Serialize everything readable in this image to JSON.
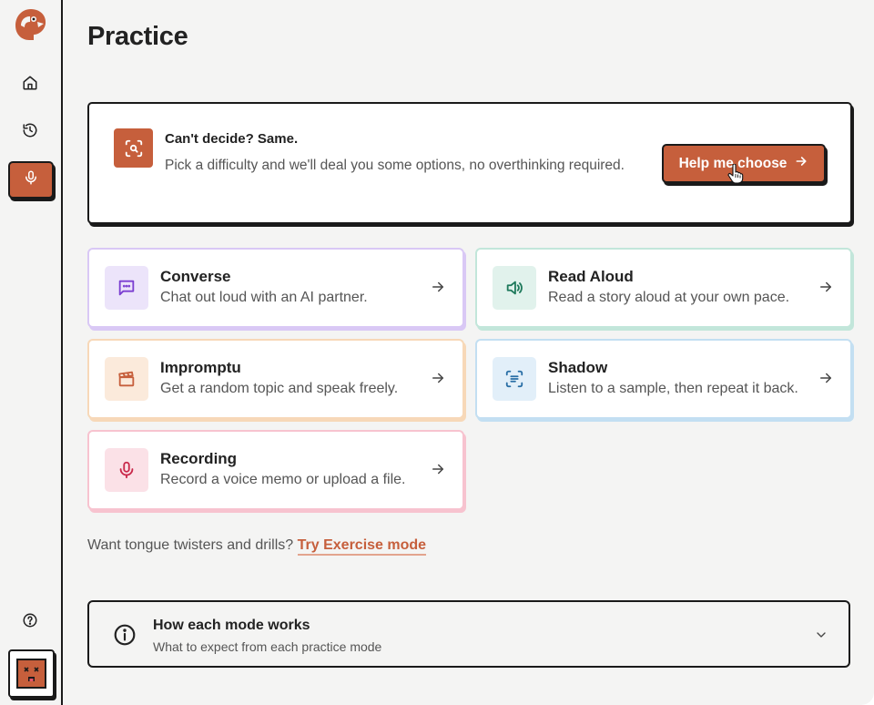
{
  "page": {
    "title": "Practice"
  },
  "colors": {
    "accent": "#c65f3c",
    "converse": "#d9c8f5",
    "read_aloud": "#c2e6da",
    "impromptu": "#f7d8b8",
    "shadow": "#c3dff2",
    "recording": "#f7c3cf"
  },
  "sidebar": {
    "logo_icon": "parrot-logo-icon",
    "items": [
      {
        "icon": "home-icon",
        "active": false
      },
      {
        "icon": "history-icon",
        "active": false
      },
      {
        "icon": "microphone-icon",
        "active": true
      }
    ],
    "bottom": [
      {
        "icon": "help-icon"
      },
      {
        "icon": "avatar"
      }
    ]
  },
  "hero": {
    "icon": "scan-search-icon",
    "title": "Can't decide? Same.",
    "description": "Pick a difficulty and we'll deal you some options, no overthinking required.",
    "button_label": "Help me choose"
  },
  "modes": [
    {
      "title": "Converse",
      "description": "Chat out loud with an AI partner.",
      "icon": "chat-bubble-icon"
    },
    {
      "title": "Read Aloud",
      "description": "Read a story aloud at your own pace.",
      "icon": "speaker-icon"
    },
    {
      "title": "Impromptu",
      "description": "Get a random topic and speak freely.",
      "icon": "clapperboard-icon"
    },
    {
      "title": "Shadow",
      "description": "Listen to a sample, then repeat it back.",
      "icon": "scan-text-icon"
    },
    {
      "title": "Recording",
      "description": "Record a voice memo or upload a file.",
      "icon": "microphone-icon"
    }
  ],
  "exercise": {
    "prompt": "Want tongue twisters and drills?",
    "link_label": "Try Exercise mode"
  },
  "accordion": {
    "title": "How each mode works",
    "subtitle": "What to expect from each practice mode"
  }
}
